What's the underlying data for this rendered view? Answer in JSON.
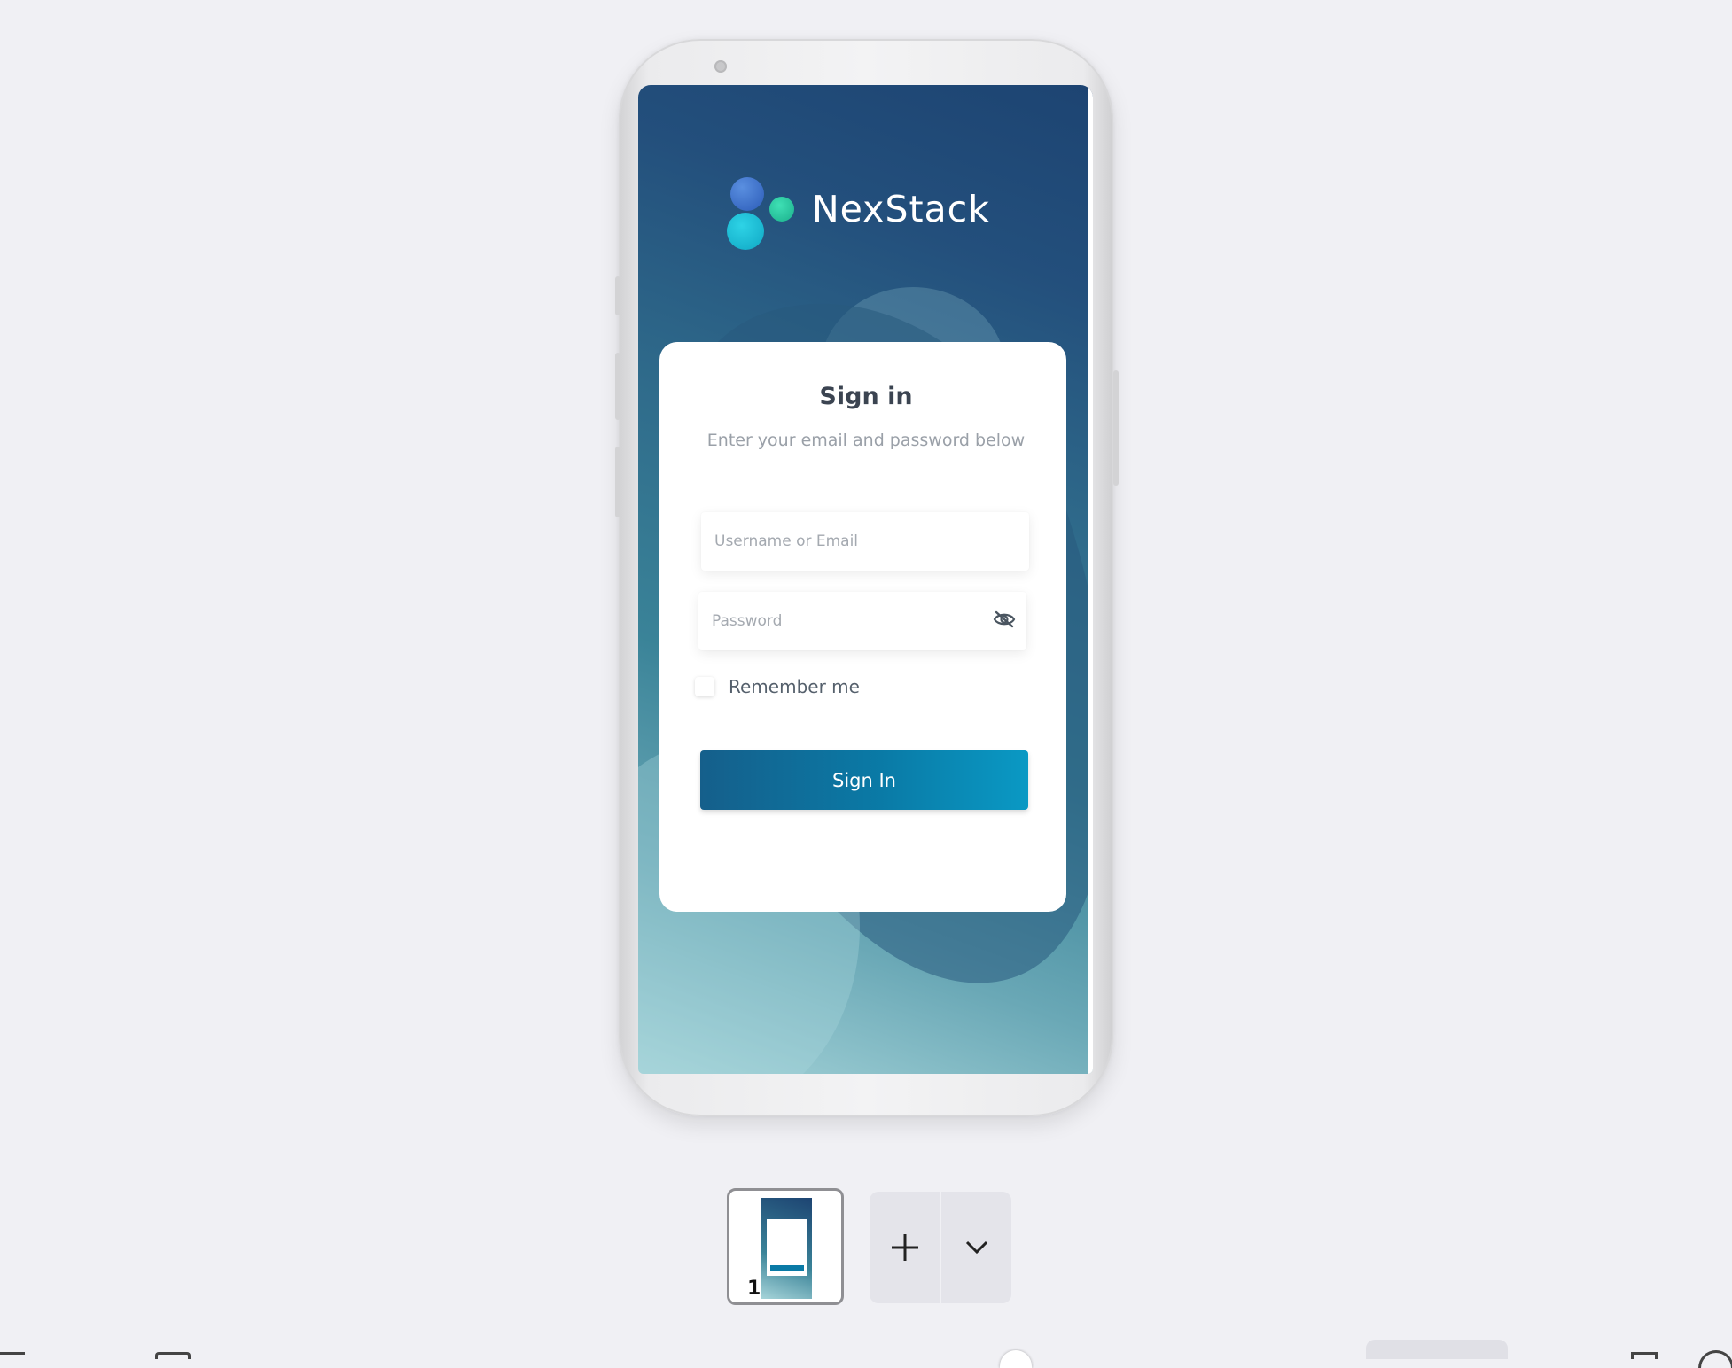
{
  "app": {
    "brand_name": "NexStack"
  },
  "login": {
    "title": "Sign in",
    "subtitle": "Enter your email and password below",
    "username_placeholder": "Username or Email",
    "password_placeholder": "Password",
    "remember_label": "Remember me",
    "submit_label": "Sign In",
    "password_toggle_icon": "eye-off-icon"
  },
  "pages": {
    "items": [
      {
        "number": "1",
        "selected": true
      }
    ],
    "add_icon": "plus-icon",
    "more_icon": "chevron-down-icon"
  },
  "colors": {
    "button_gradient_start": "#155f8b",
    "button_gradient_end": "#0a99c4",
    "background_top": "#1d4472",
    "background_bottom": "#a6d4d9"
  }
}
